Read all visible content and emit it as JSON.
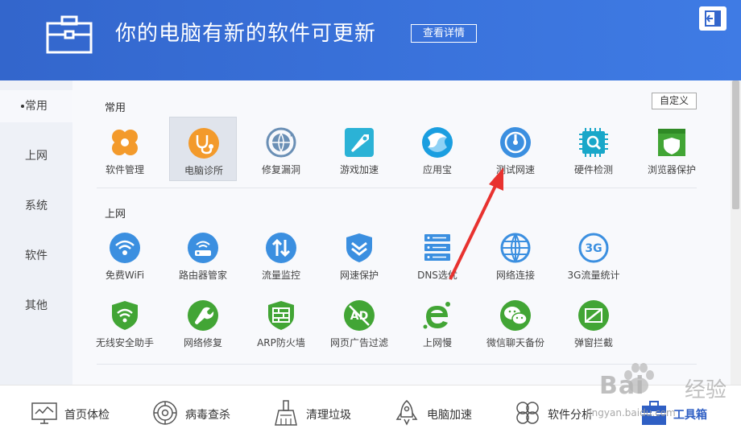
{
  "header": {
    "title": "你的电脑有新的软件可更新",
    "detail_button": "查看详情",
    "bg_color": "#3366cc"
  },
  "sidebar": {
    "items": [
      {
        "label": "常用",
        "active": true
      },
      {
        "label": "上网",
        "active": false
      },
      {
        "label": "系统",
        "active": false
      },
      {
        "label": "软件",
        "active": false
      },
      {
        "label": "其他",
        "active": false
      }
    ]
  },
  "sections": {
    "common": {
      "title": "常用",
      "customize_label": "自定义",
      "tools": [
        {
          "label": "软件管理",
          "icon": "clover-icon",
          "color": "#f39a2b"
        },
        {
          "label": "电脑诊所",
          "icon": "stethoscope-icon",
          "color": "#f39a2b",
          "selected": true
        },
        {
          "label": "修复漏洞",
          "icon": "globe-repair-icon",
          "color": "#6a8fb5"
        },
        {
          "label": "游戏加速",
          "icon": "rocket-tag-icon",
          "color": "#2bb2d6"
        },
        {
          "label": "应用宝",
          "icon": "app-treasure-icon",
          "color": "#1a9ee0"
        },
        {
          "label": "测试网速",
          "icon": "speed-gauge-icon",
          "color": "#3b8fe0"
        },
        {
          "label": "硬件检测",
          "icon": "chip-icon",
          "color": "#19a7c9"
        },
        {
          "label": "浏览器保护",
          "icon": "browser-shield-icon",
          "color": "#42a535"
        }
      ]
    },
    "internet": {
      "title": "上网",
      "tools": [
        {
          "label": "免费WiFi",
          "icon": "wifi-icon",
          "color": "#3b8fe0"
        },
        {
          "label": "路由器管家",
          "icon": "router-icon",
          "color": "#3b8fe0"
        },
        {
          "label": "流量监控",
          "icon": "traffic-arrows-icon",
          "color": "#3b8fe0"
        },
        {
          "label": "网速保护",
          "icon": "chevron-shield-icon",
          "color": "#3b8fe0"
        },
        {
          "label": "DNS选优",
          "icon": "dns-server-icon",
          "color": "#3b8fe0"
        },
        {
          "label": "网络连接",
          "icon": "globe-icon",
          "color": "#3b8fe0"
        },
        {
          "label": "3G流量统计",
          "icon": "3g-icon",
          "color": "#3b8fe0",
          "icon_text": "3G"
        },
        {
          "label": "无线安全助手",
          "icon": "wifi-shield-icon",
          "color": "#42a535"
        },
        {
          "label": "网络修复",
          "icon": "wrench-icon",
          "color": "#42a535"
        },
        {
          "label": "ARP防火墙",
          "icon": "firewall-icon",
          "color": "#42a535"
        },
        {
          "label": "网页广告过滤",
          "icon": "ad-block-icon",
          "color": "#42a535",
          "icon_text": "AD"
        },
        {
          "label": "上网慢",
          "icon": "ie-slow-icon",
          "color": "#42a535"
        },
        {
          "label": "微信聊天备份",
          "icon": "wechat-icon",
          "color": "#42a535"
        },
        {
          "label": "弹窗拦截",
          "icon": "popup-block-icon",
          "color": "#42a535"
        }
      ]
    }
  },
  "bottom_nav": [
    {
      "label": "首页体检",
      "icon": "monitor-icon"
    },
    {
      "label": "病毒查杀",
      "icon": "virus-scan-icon"
    },
    {
      "label": "清理垃圾",
      "icon": "broom-icon"
    },
    {
      "label": "电脑加速",
      "icon": "rocket-icon"
    },
    {
      "label": "软件分析",
      "icon": "clover-outline-icon"
    },
    {
      "label": "工具箱",
      "icon": "toolbox-icon",
      "active": true
    }
  ],
  "watermark": {
    "brand": "Bai",
    "jingyan": "经验",
    "url": "jingyan.baidu.com"
  }
}
